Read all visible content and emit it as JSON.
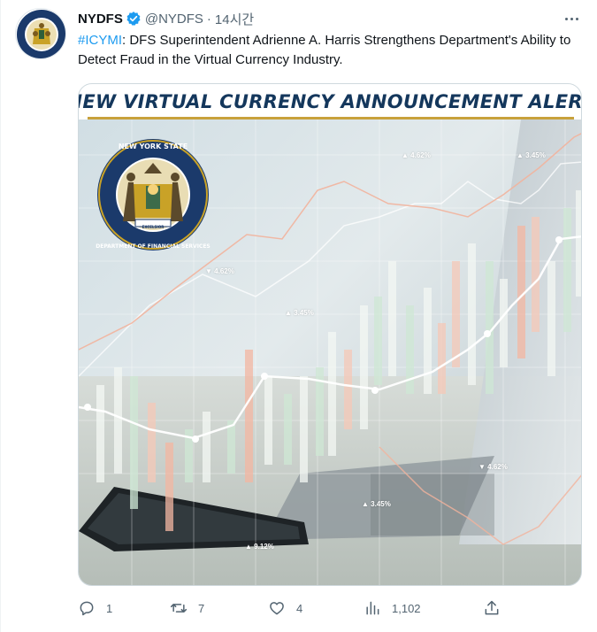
{
  "tweet": {
    "author_name": "NYDFS",
    "handle": "@NYDFS",
    "separator": "·",
    "time": "14시간",
    "hashtag": "#ICYMI",
    "body": ": DFS Superintendent Adrienne A. Harris Strengthens Department's Ability to Detect Fraud in the Virtual Currency Industry."
  },
  "media": {
    "banner_title": "NEW VIRTUAL CURRENCY ANNOUNCEMENT ALERT",
    "seal_top_text": "NEW YORK STATE",
    "seal_ring_text": "DEPARTMENT OF FINANCIAL SERVICES",
    "seal_motto": "EXCELSIOR",
    "labels": [
      "▲ 4.62%",
      "▲ 3.45%",
      "▼ 4.62%",
      "▲ 3.45%",
      "▼ 4.62%",
      "▲ 3.45%",
      "▲ 9.12%"
    ]
  },
  "actions": {
    "reply_count": "1",
    "retweet_count": "7",
    "like_count": "4",
    "view_count": "1,102"
  },
  "icons": {
    "verified": "verified-badge-icon",
    "more": "more-icon",
    "reply": "reply-icon",
    "retweet": "retweet-icon",
    "like": "like-icon",
    "views": "views-icon",
    "share": "share-icon"
  },
  "colors": {
    "accent": "#1d9bf0",
    "text": "#0f1419",
    "muted": "#536471",
    "banner_text": "#14375c",
    "banner_rule": "#c8a13b",
    "seal_navy": "#1b3a6b",
    "seal_gold": "#c9a227"
  }
}
